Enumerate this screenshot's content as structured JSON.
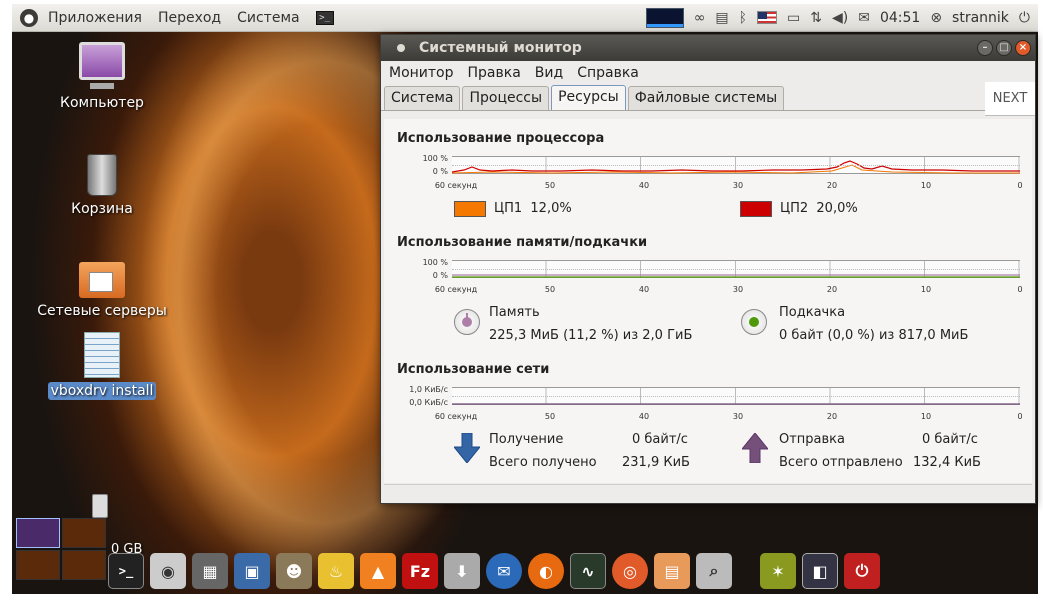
{
  "top_panel": {
    "menus": [
      "Приложения",
      "Переход",
      "Система"
    ],
    "time": "04:51",
    "user": "strannik"
  },
  "desktop": {
    "icons": [
      {
        "label": "Компьютер",
        "icon": "computer-icon"
      },
      {
        "label": "Корзина",
        "icon": "trash-icon"
      },
      {
        "label": "Сетевые серверы",
        "icon": "network-folder-icon"
      },
      {
        "label": "vboxdrv install",
        "icon": "text-document-icon"
      }
    ],
    "drive_label": "0 GB",
    "workspace_number": "1"
  },
  "window": {
    "title": "Системный монитор",
    "menu": [
      "Монитор",
      "Правка",
      "Вид",
      "Справка"
    ],
    "tabs": [
      "Система",
      "Процессы",
      "Ресурсы",
      "Файловые системы"
    ],
    "active_tab": "Ресурсы",
    "cpu": {
      "title": "Использование процессора",
      "y_top": "100 %",
      "y_bottom": "0 %",
      "legend": [
        {
          "label": "ЦП1",
          "value": "12,0%",
          "color": "#f57900"
        },
        {
          "label": "ЦП2",
          "value": "20,0%",
          "color": "#cc0000"
        }
      ]
    },
    "memory": {
      "title": "Использование памяти/подкачки",
      "y_top": "100 %",
      "y_bottom": "0 %",
      "mem_label": "Память",
      "mem_value": "225,3 МиБ (11,2 %) из 2,0 ГиБ",
      "swap_label": "Подкачка",
      "swap_value": "0 байт (0,0 %) из 817,0 МиБ",
      "mem_color": "#ad7fa8",
      "swap_color": "#4e9a06"
    },
    "network": {
      "title": "Использование сети",
      "y_top": "1,0 КиБ/с",
      "y_bottom": "0,0 КиБ/с",
      "recv_label": "Получение",
      "recv_rate": "0 байт/с",
      "recv_total_label": "Всего получено",
      "recv_total": "231,9 КиБ",
      "send_label": "Отправка",
      "send_rate": "0 байт/с",
      "send_total_label": "Всего отправлено",
      "send_total": "132,4 КиБ",
      "recv_color": "#3465a4",
      "send_color": "#75507b"
    },
    "x_ticks": [
      "60 секунд",
      "50",
      "40",
      "30",
      "20",
      "10",
      "0"
    ]
  },
  "next_badge": "NEXT",
  "dock_icons": [
    "terminal-icon",
    "camera-icon",
    "calculator-icon",
    "virtualbox-icon",
    "gimp-icon",
    "genie-lamp-icon",
    "vlc-icon",
    "filezilla-icon",
    "installer-icon",
    "thunderbird-icon",
    "firefox-icon",
    "system-monitor-icon",
    "ubuntu-icon",
    "files-icon",
    "search-icon",
    "photo-icon",
    "window-icon",
    "power-icon"
  ],
  "colors": {
    "titlebar": "#3c3b37",
    "window_bg": "#edeceb",
    "cpu1": "#f57900",
    "cpu2": "#cc0000"
  }
}
